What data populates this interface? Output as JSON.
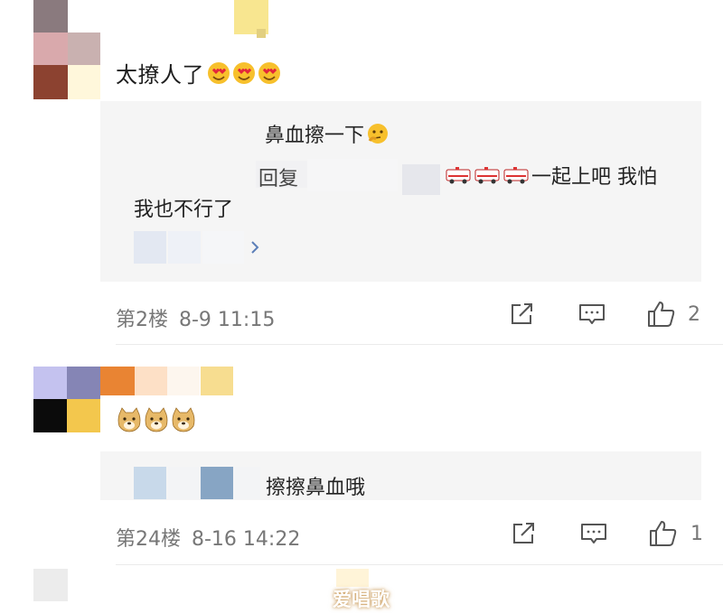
{
  "comments": [
    {
      "text": "太撩人了",
      "reactions": [
        "heart-eyes-emoji",
        "heart-eyes-emoji",
        "heart-eyes-emoji"
      ],
      "replies": {
        "line1": "鼻血擦一下",
        "line1_emoji": "thinking-emoji",
        "line2_prefix": "回复",
        "line2_emoji": [
          "ambulance-emoji",
          "ambulance-emoji",
          "ambulance-emoji"
        ],
        "line2_suffix": "一起上吧 我怕",
        "line3": "我也不行了",
        "more_icon": "chevron-right-icon"
      },
      "floor": "第2楼",
      "time": "8-9 11:15",
      "likes": "2"
    },
    {
      "text": "",
      "reactions": [
        "doge-emoji",
        "doge-emoji",
        "doge-emoji"
      ],
      "replies": {
        "line1": "擦擦鼻血哦"
      },
      "floor": "第24楼",
      "time": "8-16 14:22",
      "likes": "1"
    }
  ],
  "actions": {
    "share_icon": "share-icon",
    "comment_icon": "comment-icon",
    "like_icon": "thumbs-up-icon"
  },
  "watermark": "爱唱歌"
}
